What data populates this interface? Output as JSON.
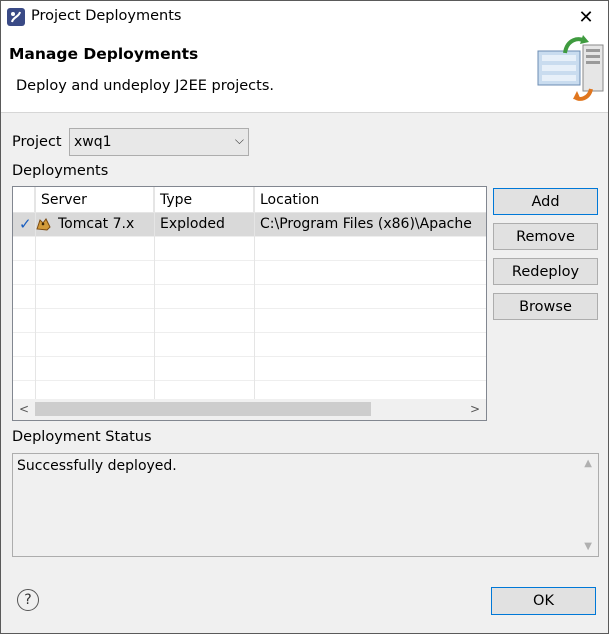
{
  "window": {
    "title": "Project Deployments",
    "close_glyph": "✕"
  },
  "header": {
    "title": "Manage Deployments",
    "description": "Deploy and undeploy J2EE projects."
  },
  "project": {
    "label": "Project",
    "selected": "xwq1"
  },
  "deployments": {
    "label": "Deployments",
    "columns": [
      "Server",
      "Type",
      "Location"
    ],
    "rows": [
      {
        "checked": true,
        "server": "Tomcat  7.x",
        "type": "Exploded",
        "location": "C:\\Program Files (x86)\\Apache"
      }
    ]
  },
  "buttons": {
    "add": "Add",
    "remove": "Remove",
    "redeploy": "Redeploy",
    "browse": "Browse"
  },
  "status": {
    "label": "Deployment Status",
    "text": "Successfully deployed."
  },
  "footer": {
    "ok": "OK",
    "help_glyph": "?"
  },
  "icons": {
    "app": "myeclipse-icon",
    "header": "deploy-servers-icon",
    "server": "tomcat-icon",
    "check": "check-icon"
  }
}
